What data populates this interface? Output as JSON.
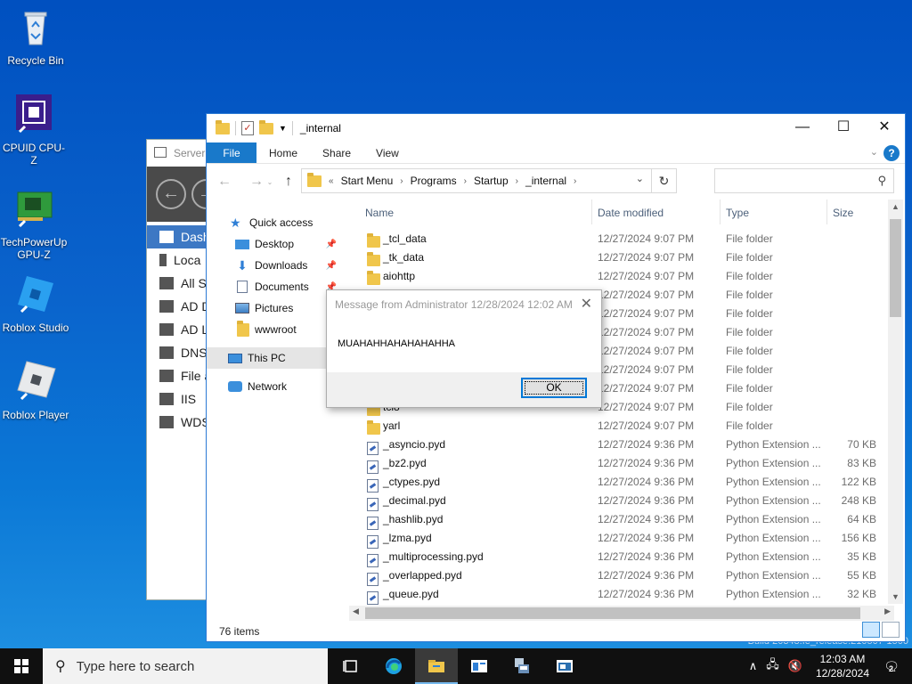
{
  "desktop": {
    "icons": [
      {
        "label": "Recycle Bin"
      },
      {
        "label": "CPUID CPU-Z"
      },
      {
        "label": "TechPowerUp GPU-Z"
      },
      {
        "label": "Roblox Studio"
      },
      {
        "label": "Roblox Player"
      }
    ],
    "build_text": "Build 20348.fe_release.210507-1500"
  },
  "server_manager": {
    "title": "Server M",
    "items": [
      "Dash",
      "Loca",
      "All S",
      "AD D",
      "AD L",
      "DNS",
      "File a",
      "IIS",
      "WDS"
    ]
  },
  "explorer": {
    "title": "_internal",
    "ribbon_tabs": [
      "File",
      "Home",
      "Share",
      "View"
    ],
    "breadcrumb": [
      "Start Menu",
      "Programs",
      "Startup",
      "_internal"
    ],
    "breadcrumb_prefix": "«",
    "nav": {
      "quick_access": "Quick access",
      "items": [
        {
          "label": "Desktop",
          "pinned": true
        },
        {
          "label": "Downloads",
          "pinned": true
        },
        {
          "label": "Documents",
          "pinned": true
        },
        {
          "label": "Pictures",
          "pinned": true
        },
        {
          "label": "wwwroot",
          "pinned": false
        }
      ],
      "this_pc": "This PC",
      "network": "Network"
    },
    "columns": {
      "name": "Name",
      "date": "Date modified",
      "type": "Type",
      "size": "Size"
    },
    "rows": [
      {
        "name": "_tcl_data",
        "date": "12/27/2024 9:07 PM",
        "type": "File folder",
        "size": "",
        "kind": "folder"
      },
      {
        "name": "_tk_data",
        "date": "12/27/2024 9:07 PM",
        "type": "File folder",
        "size": "",
        "kind": "folder"
      },
      {
        "name": "aiohttp",
        "date": "12/27/2024 9:07 PM",
        "type": "File folder",
        "size": "",
        "kind": "folder"
      },
      {
        "name": "",
        "date": "12/27/2024 9:07 PM",
        "type": "File folder",
        "size": "",
        "kind": "folder"
      },
      {
        "name": "",
        "date": "12/27/2024 9:07 PM",
        "type": "File folder",
        "size": "",
        "kind": "folder"
      },
      {
        "name": "",
        "date": "12/27/2024 9:07 PM",
        "type": "File folder",
        "size": "",
        "kind": "folder"
      },
      {
        "name": "",
        "date": "12/27/2024 9:07 PM",
        "type": "File folder",
        "size": "",
        "kind": "folder"
      },
      {
        "name": "",
        "date": "12/27/2024 9:07 PM",
        "type": "File folder",
        "size": "",
        "kind": "folder"
      },
      {
        "name": "",
        "date": "12/27/2024 9:07 PM",
        "type": "File folder",
        "size": "",
        "kind": "folder"
      },
      {
        "name": "tcl8",
        "date": "12/27/2024 9:07 PM",
        "type": "File folder",
        "size": "",
        "kind": "folder"
      },
      {
        "name": "yarl",
        "date": "12/27/2024 9:07 PM",
        "type": "File folder",
        "size": "",
        "kind": "folder"
      },
      {
        "name": "_asyncio.pyd",
        "date": "12/27/2024 9:36 PM",
        "type": "Python Extension ...",
        "size": "70 KB",
        "kind": "pyd"
      },
      {
        "name": "_bz2.pyd",
        "date": "12/27/2024 9:36 PM",
        "type": "Python Extension ...",
        "size": "83 KB",
        "kind": "pyd"
      },
      {
        "name": "_ctypes.pyd",
        "date": "12/27/2024 9:36 PM",
        "type": "Python Extension ...",
        "size": "122 KB",
        "kind": "pyd"
      },
      {
        "name": "_decimal.pyd",
        "date": "12/27/2024 9:36 PM",
        "type": "Python Extension ...",
        "size": "248 KB",
        "kind": "pyd"
      },
      {
        "name": "_hashlib.pyd",
        "date": "12/27/2024 9:36 PM",
        "type": "Python Extension ...",
        "size": "64 KB",
        "kind": "pyd"
      },
      {
        "name": "_lzma.pyd",
        "date": "12/27/2024 9:36 PM",
        "type": "Python Extension ...",
        "size": "156 KB",
        "kind": "pyd"
      },
      {
        "name": "_multiprocessing.pyd",
        "date": "12/27/2024 9:36 PM",
        "type": "Python Extension ...",
        "size": "35 KB",
        "kind": "pyd"
      },
      {
        "name": "_overlapped.pyd",
        "date": "12/27/2024 9:36 PM",
        "type": "Python Extension ...",
        "size": "55 KB",
        "kind": "pyd"
      },
      {
        "name": "_queue.pyd",
        "date": "12/27/2024 9:36 PM",
        "type": "Python Extension ...",
        "size": "32 KB",
        "kind": "pyd"
      }
    ],
    "status": "76 items"
  },
  "message": {
    "title": "Message from Administrator 12/28/2024 12:02 AM",
    "text": "MUAHAHHAHAHAHAHHA",
    "ok_label": "OK"
  },
  "taskbar": {
    "search_placeholder": "Type here to search",
    "time": "12:03 AM",
    "date": "12/28/2024",
    "notification_count": "2"
  },
  "colors": {
    "accent": "#0078d7",
    "file_tab": "#1979ca",
    "folder": "#f0c64b"
  }
}
